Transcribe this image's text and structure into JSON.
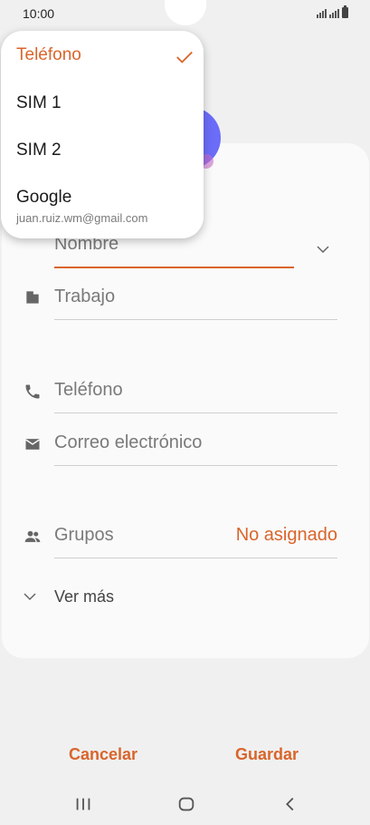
{
  "status_bar": {
    "time": "10:00"
  },
  "form": {
    "name_placeholder": "Nombre",
    "work_placeholder": "Trabajo",
    "phone_placeholder": "Teléfono",
    "email_placeholder": "Correo electrónico",
    "groups_label": "Grupos",
    "groups_value": "No asignado",
    "see_more": "Ver más"
  },
  "actions": {
    "cancel": "Cancelar",
    "save": "Guardar"
  },
  "storage_menu": {
    "items": [
      {
        "label": "Teléfono",
        "selected": true
      },
      {
        "label": "SIM 1"
      },
      {
        "label": "SIM 2"
      },
      {
        "label": "Google",
        "sub": "juan.ruiz.wm@gmail.com"
      }
    ]
  },
  "colors": {
    "accent": "#d9652b",
    "avatar": "#6b6cf8"
  }
}
